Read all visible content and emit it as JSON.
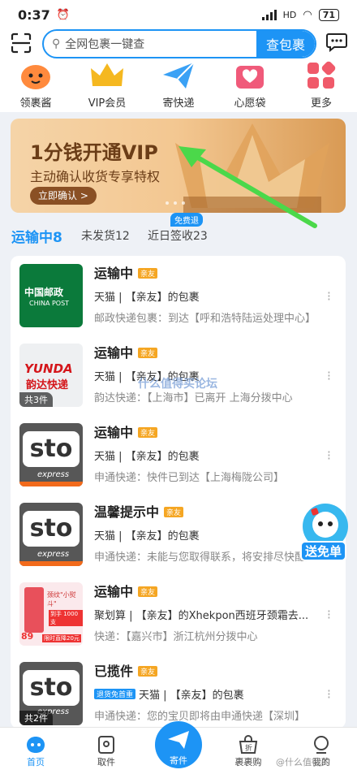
{
  "status": {
    "time": "0:37",
    "battery": "71",
    "network": "HD"
  },
  "search": {
    "placeholder": "全网包裹一键查",
    "button": "查包裹"
  },
  "quick_icons": [
    {
      "label": "领裹酱",
      "icon": "mascot-icon"
    },
    {
      "label": "VIP会员",
      "icon": "crown-icon"
    },
    {
      "label": "寄快递",
      "icon": "paper-plane-icon"
    },
    {
      "label": "心愿袋",
      "icon": "heart-bag-icon"
    },
    {
      "label": "更多",
      "icon": "grid-icon"
    }
  ],
  "banner": {
    "title": "1分钱开通VIP",
    "subtitle": "主动确认收货专享特权",
    "button": "立即确认 >"
  },
  "tabs": {
    "free_badge": "免费退",
    "items": [
      {
        "label": "运输中8"
      },
      {
        "label": "未发货12"
      },
      {
        "label": "近日签收23"
      }
    ]
  },
  "packages": [
    {
      "status": "运输中",
      "tag": "亲友",
      "source": "天猫 | 【亲友】的包裹",
      "detail": "邮政快递包裹：到达【呼和浩特陆运处理中心】",
      "logo": "中国邮政",
      "logo_sub": "CHINA POST",
      "count": ""
    },
    {
      "status": "运输中",
      "tag": "亲友",
      "source": "天猫 | 【亲友】的包裹",
      "detail": "韵达快递：【上海市】已离开 上海分拨中心",
      "logo": "YUNDA",
      "logo_sub": "韵达快递",
      "count": "共3件"
    },
    {
      "status": "运输中",
      "tag": "亲友",
      "source": "天猫 | 【亲友】的包裹",
      "detail": "申通快递：快件已到达【上海梅陇公司】",
      "logo": "sto",
      "logo_sub": "express",
      "count": ""
    },
    {
      "status": "温馨提示中",
      "tag": "亲友",
      "source": "天猫 | 【亲友】的包裹",
      "detail": "申通快递：未能与您取得联系，将安排尽快配送",
      "logo": "sto",
      "logo_sub": "express",
      "count": ""
    },
    {
      "status": "运输中",
      "tag": "亲友",
      "source": "聚划算 | 【亲友】的Xhekpon西班牙颈霜去...",
      "detail": "快递：【嘉兴市】浙江杭州分拨中心",
      "logo": "",
      "logo_sub": "",
      "count": "",
      "price": "89",
      "promo": "限时直降20元",
      "promo2": "颈纹\"小熨斗\"",
      "promo3": "到手 1000支"
    },
    {
      "status": "已揽件",
      "tag": "亲友",
      "source": "天猫 | 【亲友】的包裹",
      "source_tag": "退货免首重",
      "detail": "申通快递：您的宝贝即将由申通快递【深圳】",
      "logo": "sto",
      "logo_sub": "express",
      "count": "共2件"
    }
  ],
  "float_badge": "送免单",
  "watermark": "什么值得买论坛",
  "watermark2": "@什么值得买",
  "bottom_nav": [
    {
      "label": "首页",
      "icon": "home-icon"
    },
    {
      "label": "取件",
      "icon": "locker-icon"
    },
    {
      "label": "寄件",
      "icon": "send-icon"
    },
    {
      "label": "裹裹购",
      "icon": "shopping-bag-icon"
    },
    {
      "label": "我的",
      "icon": "profile-icon"
    }
  ]
}
